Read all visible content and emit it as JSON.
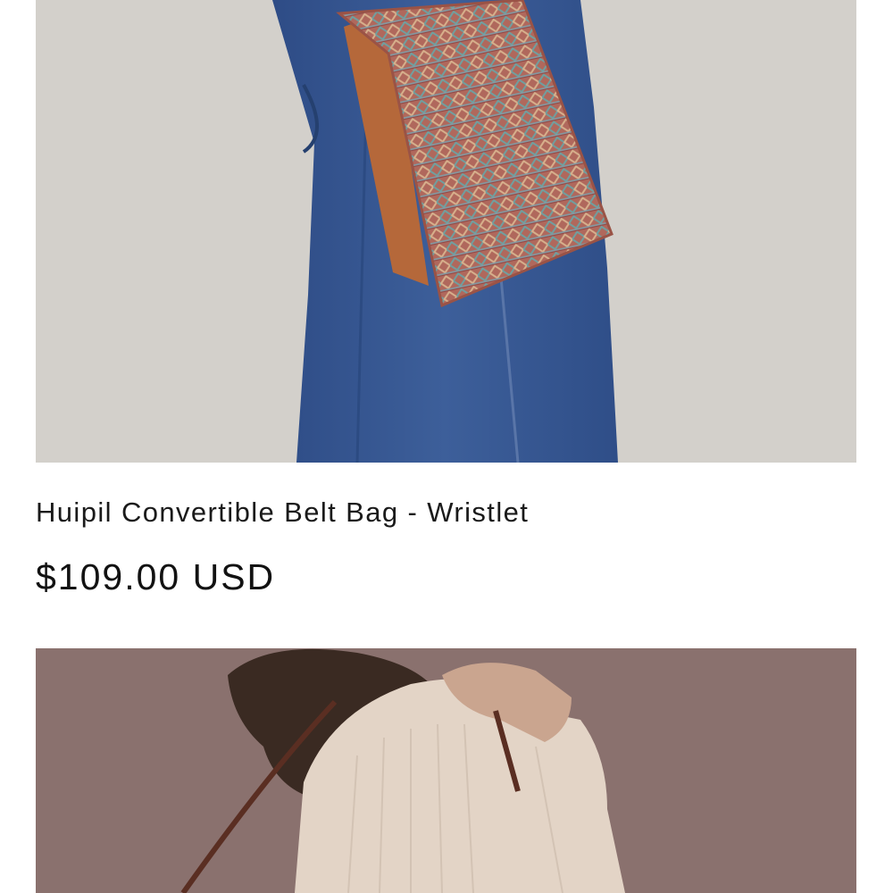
{
  "products": [
    {
      "title": "Huipil Convertible Belt Bag - Wristlet",
      "price": "$109.00 USD",
      "image": "belt-bag-photo",
      "colors": {
        "background": "#d3d0cb",
        "denim": "#34558f",
        "bag_leather": "#b5683a",
        "bag_weave": "#b06a5c"
      }
    },
    {
      "image": "crossbody-bag-photo",
      "colors": {
        "background": "#8a716e",
        "sweater": "#e3d4c6",
        "hair": "#3a2a22"
      }
    }
  ]
}
